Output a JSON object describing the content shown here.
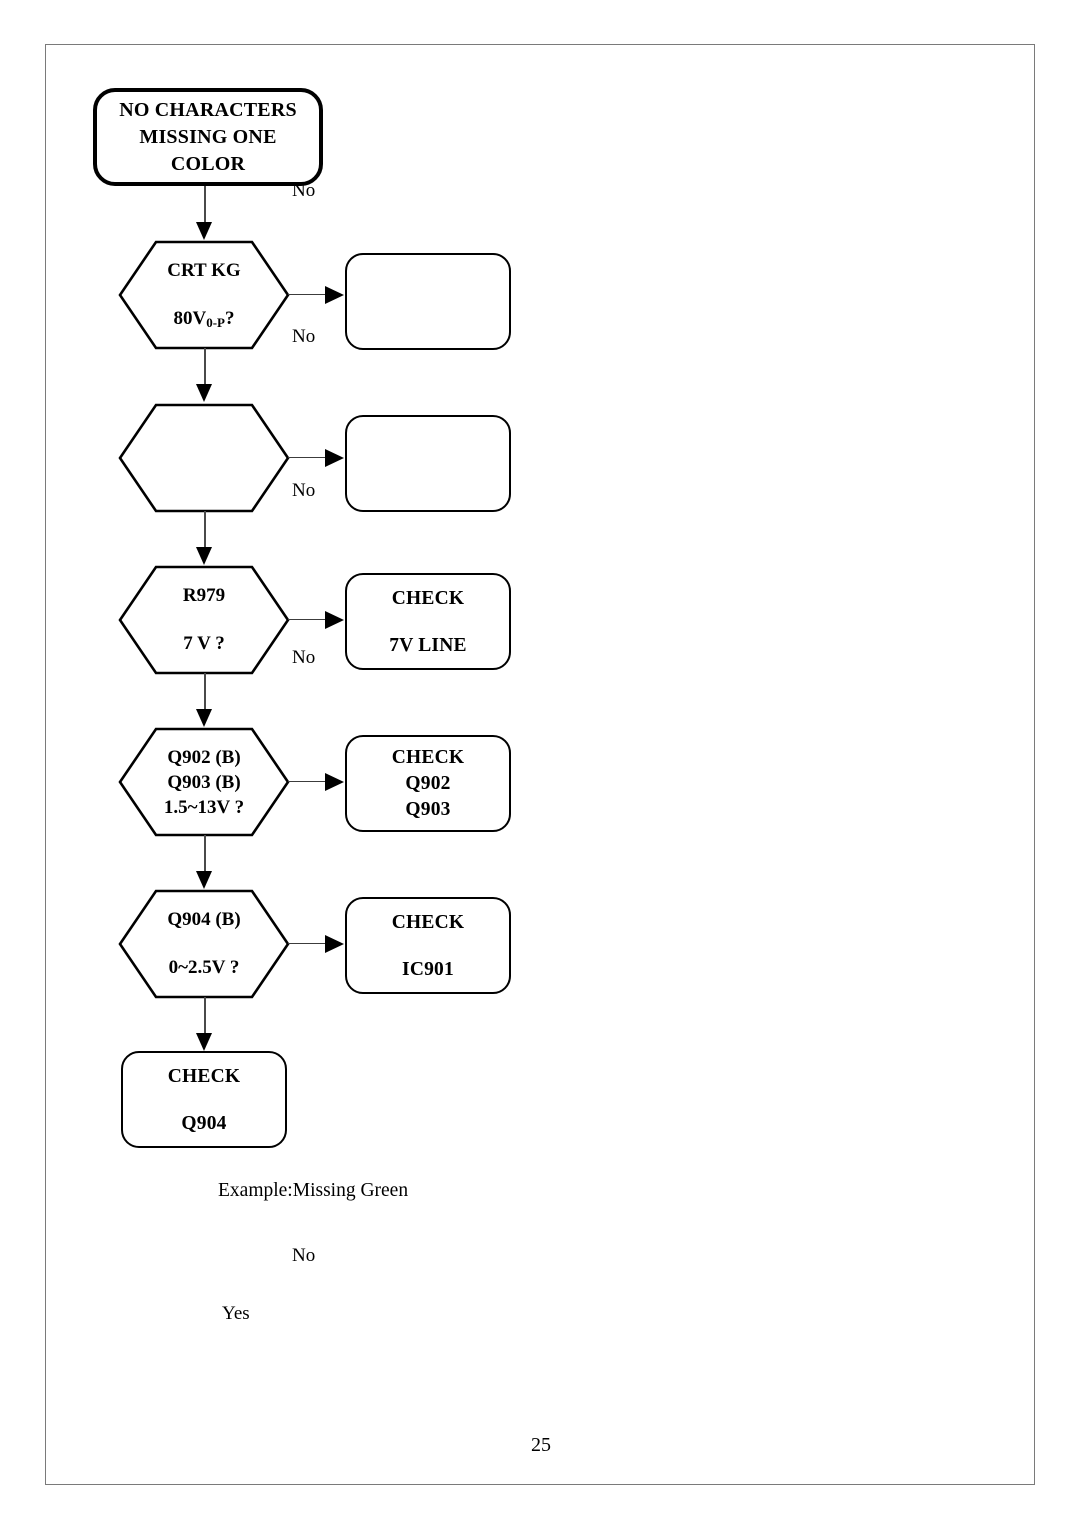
{
  "document": {
    "page_number": "25"
  },
  "flowchart": {
    "start": {
      "lines": [
        "NO CHARACTERS",
        "MISSING ONE",
        "COLOR"
      ]
    },
    "steps": [
      {
        "decision": {
          "lines": [
            "CRT  KG",
            "80V",
            "0-P",
            "?"
          ],
          "line1": "CRT  KG",
          "value": "80V",
          "subscript": "0-P",
          "suffix": "?"
        },
        "branch_label": "No",
        "result": {
          "lines": [
            "",
            ""
          ]
        }
      },
      {
        "decision": {
          "lines": [
            "",
            ""
          ]
        },
        "branch_label": "No",
        "result": {
          "lines": [
            "",
            ""
          ]
        }
      },
      {
        "decision": {
          "lines": [
            "R979",
            "7 V ?"
          ]
        },
        "branch_label": "No",
        "result": {
          "lines": [
            "CHECK",
            "7V  LINE"
          ]
        }
      },
      {
        "decision": {
          "lines": [
            "Q902 (B)",
            "Q903 (B)",
            "1.5~13V ?"
          ]
        },
        "branch_label": "",
        "result": {
          "lines": [
            "CHECK",
            "Q902",
            "Q903"
          ]
        }
      },
      {
        "decision": {
          "lines": [
            "Q904 (B)",
            "0~2.5V ?"
          ]
        },
        "branch_label": "",
        "result": {
          "lines": [
            "CHECK",
            "IC901"
          ]
        }
      }
    ],
    "terminal": {
      "lines": [
        "CHECK",
        "Q904"
      ]
    },
    "stray_labels": {
      "top_no": "No",
      "example": "Example:Missing Green",
      "mid_no": "No",
      "yes": "Yes"
    }
  },
  "colors": {
    "ink": "#000000",
    "border": "#7a7a7a",
    "connector": "#3c3c3c",
    "background": "#ffffff"
  }
}
